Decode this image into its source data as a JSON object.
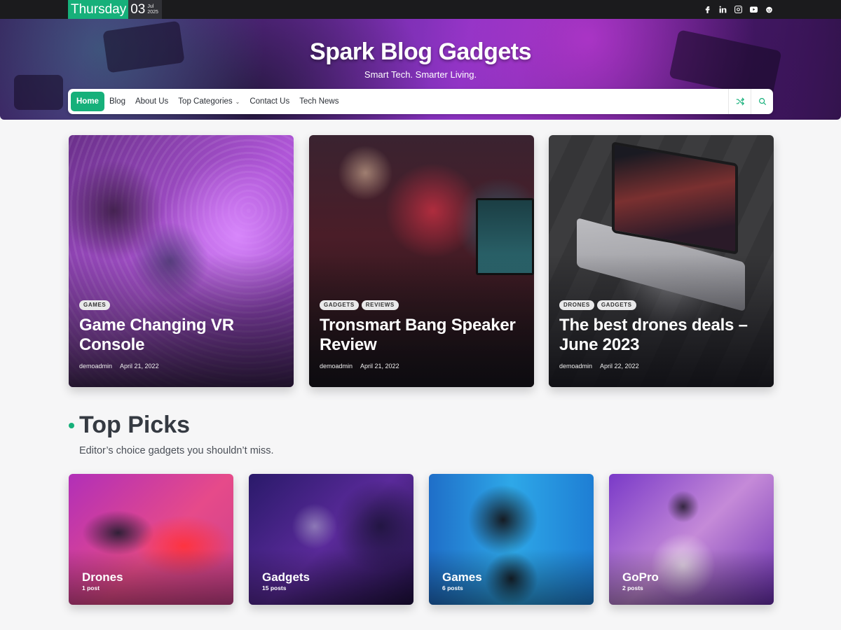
{
  "topbar": {
    "day": "Thursday",
    "date_num": "03",
    "month": "Jul",
    "year": "2025",
    "socials": [
      "facebook-icon",
      "linkedin-icon",
      "instagram-icon",
      "youtube-icon",
      "reddit-icon"
    ]
  },
  "header": {
    "site_title": "Spark Blog Gadgets",
    "tagline": "Smart Tech. Smarter Living."
  },
  "nav": {
    "items": [
      {
        "label": "Home",
        "active": true
      },
      {
        "label": "Blog"
      },
      {
        "label": "About Us"
      },
      {
        "label": "Top Categories",
        "has_dropdown": true
      },
      {
        "label": "Contact Us"
      },
      {
        "label": "Tech News"
      }
    ],
    "tools": [
      "shuffle-icon",
      "search-icon"
    ]
  },
  "featured": [
    {
      "tags": [
        "GAMES"
      ],
      "title": "Game Changing VR Console",
      "author": "demoadmin",
      "date": "April 21, 2022"
    },
    {
      "tags": [
        "GADGETS",
        "REVIEWS"
      ],
      "title": "Tronsmart Bang Speaker Review",
      "author": "demoadmin",
      "date": "April 21, 2022"
    },
    {
      "tags": [
        "DRONES",
        "GADGETS"
      ],
      "title": "The best drones deals – June 2023",
      "author": "demoadmin",
      "date": "April 22, 2022"
    }
  ],
  "top_picks": {
    "title": "Top Picks",
    "subtitle": "Editor’s choice gadgets you shouldn’t miss.",
    "cards": [
      {
        "name": "Drones",
        "count": "1 post"
      },
      {
        "name": "Gadgets",
        "count": "15 posts"
      },
      {
        "name": "Games",
        "count": "6 posts"
      },
      {
        "name": "GoPro",
        "count": "2 posts"
      }
    ]
  },
  "colors": {
    "accent": "#16b07a",
    "topbar": "#1b1b1d"
  }
}
